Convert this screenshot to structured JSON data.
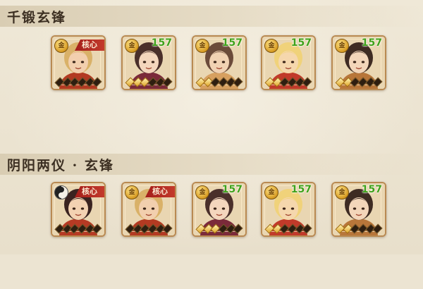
{
  "sections": [
    {
      "title": "千锻玄锋",
      "cards": [
        {
          "badge": "coin",
          "coin_glyph": "金",
          "level": "",
          "core": "核心",
          "portrait": {
            "skin": "#f2cfae",
            "hair": "#d9b168",
            "outfit": "#b33a22"
          },
          "gold_stars": 0
        },
        {
          "badge": "coin",
          "coin_glyph": "金",
          "level": "157",
          "core": "",
          "portrait": {
            "skin": "#f4d6bd",
            "hair": "#4a2f2a",
            "outfit": "#7b2a3a"
          },
          "gold_stars": 3
        },
        {
          "badge": "coin",
          "coin_glyph": "金",
          "level": "157",
          "core": "",
          "portrait": {
            "skin": "#f1d2b3",
            "hair": "#6b4b3a",
            "outfit": "#d7a060"
          },
          "gold_stars": 2
        },
        {
          "badge": "coin",
          "coin_glyph": "金",
          "level": "157",
          "core": "",
          "portrait": {
            "skin": "#f5d7ad",
            "hair": "#f0d27a",
            "outfit": "#c13a2a"
          },
          "gold_stars": 2
        },
        {
          "badge": "coin",
          "coin_glyph": "金",
          "level": "157",
          "core": "",
          "portrait": {
            "skin": "#f3d6ba",
            "hair": "#3e2b22",
            "outfit": "#b8763a"
          },
          "gold_stars": 2
        }
      ]
    },
    {
      "title": "阴阳两仪 · 玄锋",
      "cards": [
        {
          "badge": "yinyang",
          "coin_glyph": "",
          "level": "",
          "core": "核心",
          "portrait": {
            "skin": "#f3d2b2",
            "hair": "#3a2320",
            "outfit": "#b63a24"
          },
          "gold_stars": 0
        },
        {
          "badge": "coin",
          "coin_glyph": "金",
          "level": "",
          "core": "核心",
          "portrait": {
            "skin": "#f2cfae",
            "hair": "#d9b168",
            "outfit": "#b33a22"
          },
          "gold_stars": 0
        },
        {
          "badge": "coin",
          "coin_glyph": "金",
          "level": "157",
          "core": "",
          "portrait": {
            "skin": "#f4d6bd",
            "hair": "#4a2f2a",
            "outfit": "#7b2a3a"
          },
          "gold_stars": 3
        },
        {
          "badge": "coin",
          "coin_glyph": "金",
          "level": "157",
          "core": "",
          "portrait": {
            "skin": "#f5d7ad",
            "hair": "#f0d27a",
            "outfit": "#c13a2a"
          },
          "gold_stars": 2
        },
        {
          "badge": "coin",
          "coin_glyph": "金",
          "level": "157",
          "core": "",
          "portrait": {
            "skin": "#f3d6ba",
            "hair": "#3e2b22",
            "outfit": "#b8763a"
          },
          "gold_stars": 2
        }
      ]
    }
  ]
}
